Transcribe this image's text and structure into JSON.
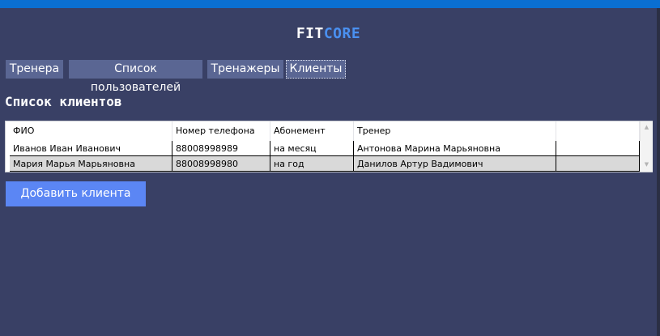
{
  "brand": {
    "part1": "FIT",
    "part2": "CORE"
  },
  "tabs": [
    {
      "label": "Тренера"
    },
    {
      "label": "Список пользователей"
    },
    {
      "label": "Тренажеры"
    },
    {
      "label": "Клиенты",
      "active": true
    }
  ],
  "section_title": "Список клиентов",
  "table": {
    "columns": [
      "ФИО",
      "Номер телефона",
      "Абонемент",
      "Тренер",
      ""
    ],
    "rows": [
      [
        "Иванов Иван Иванович",
        "88008998989",
        "на месяц",
        "Антонова Марина Марьяновна",
        ""
      ],
      [
        "Мария Марья Марьяновна",
        "88008998980",
        "на год",
        "Данилов Артур Вадимович",
        ""
      ]
    ]
  },
  "add_button_label": "Добавить клиента",
  "colors": {
    "background": "#394065",
    "titlebar": "#0a6fd1",
    "tab": "#5a6693",
    "brand_accent": "#4a90f0",
    "button": "#5b86f4",
    "selected_row": "#d9d9d9"
  },
  "icons": {
    "scroll_up": "chevron-up-icon",
    "scroll_down": "chevron-down-icon"
  }
}
